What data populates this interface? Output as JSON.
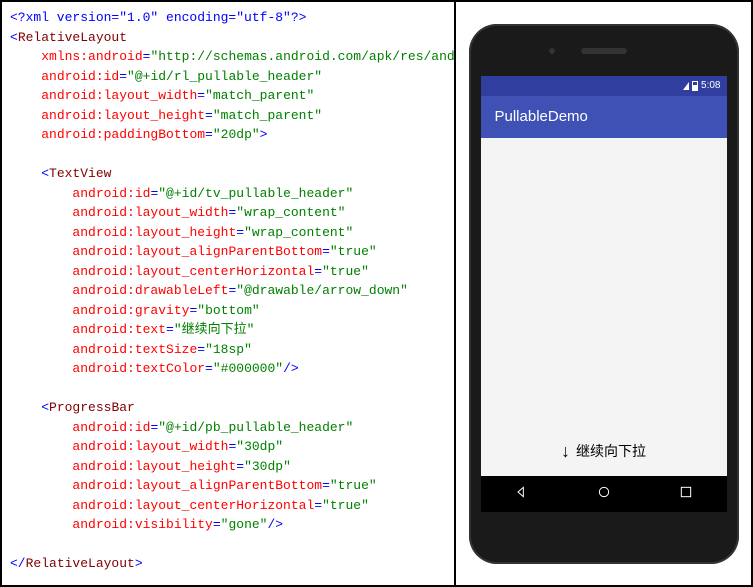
{
  "code": {
    "xml_decl": "<?xml version=\"1.0\" encoding=\"utf-8\"?>",
    "root_tag": "RelativeLayout",
    "root_attrs": [
      {
        "name": "xmlns:android",
        "value": "http://schemas.android.com/apk/res/android"
      },
      {
        "name": "android:id",
        "value": "@+id/rl_pullable_header"
      },
      {
        "name": "android:layout_width",
        "value": "match_parent"
      },
      {
        "name": "android:layout_height",
        "value": "match_parent"
      },
      {
        "name": "android:paddingBottom",
        "value": "20dp"
      }
    ],
    "children": [
      {
        "tag": "TextView",
        "attrs": [
          {
            "name": "android:id",
            "value": "@+id/tv_pullable_header"
          },
          {
            "name": "android:layout_width",
            "value": "wrap_content"
          },
          {
            "name": "android:layout_height",
            "value": "wrap_content"
          },
          {
            "name": "android:layout_alignParentBottom",
            "value": "true"
          },
          {
            "name": "android:layout_centerHorizontal",
            "value": "true"
          },
          {
            "name": "android:drawableLeft",
            "value": "@drawable/arrow_down"
          },
          {
            "name": "android:gravity",
            "value": "bottom"
          },
          {
            "name": "android:text",
            "value": "继续向下拉"
          },
          {
            "name": "android:textSize",
            "value": "18sp"
          },
          {
            "name": "android:textColor",
            "value": "#000000"
          }
        ]
      },
      {
        "tag": "ProgressBar",
        "attrs": [
          {
            "name": "android:id",
            "value": "@+id/pb_pullable_header"
          },
          {
            "name": "android:layout_width",
            "value": "30dp"
          },
          {
            "name": "android:layout_height",
            "value": "30dp"
          },
          {
            "name": "android:layout_alignParentBottom",
            "value": "true"
          },
          {
            "name": "android:layout_centerHorizontal",
            "value": "true"
          },
          {
            "name": "android:visibility",
            "value": "gone"
          }
        ]
      }
    ],
    "root_close": "RelativeLayout"
  },
  "device": {
    "status_time": "5:08",
    "app_title": "PullableDemo",
    "pull_hint": "继续向下拉"
  }
}
